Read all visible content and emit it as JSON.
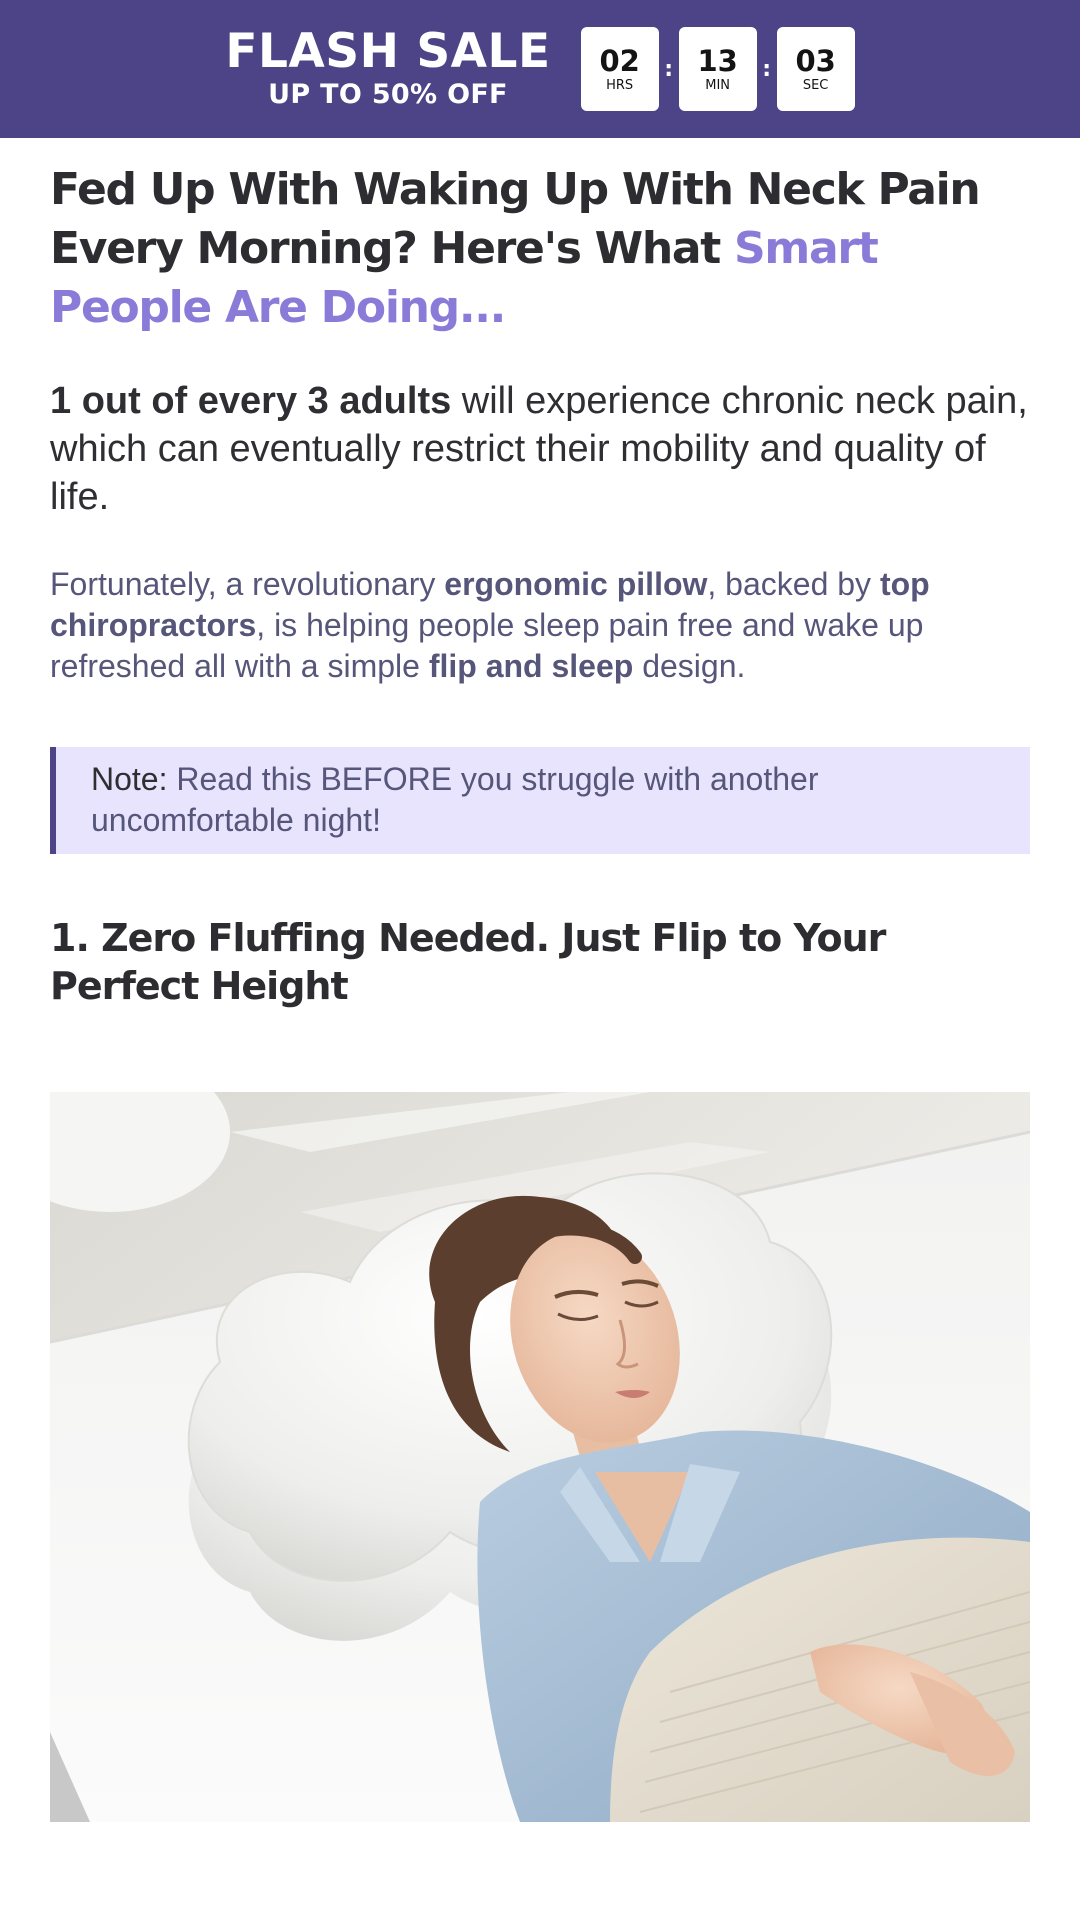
{
  "banner": {
    "title": "FLASH SALE",
    "subtitle": "UP TO 50% OFF",
    "background_color": "#4c4486",
    "timer": {
      "hours": "02",
      "hours_label": "HRS",
      "minutes": "13",
      "minutes_label": "MIN",
      "seconds": "03",
      "seconds_label": "SEC",
      "separator": ":"
    }
  },
  "article": {
    "headline_main": "Fed Up With Waking Up With Neck Pain Every Morning? Here's What ",
    "headline_accent": "Smart People Are Doing...",
    "accent_color": "#8b7bd8",
    "lead_bold": "1 out of every 3 adults",
    "lead_rest": " will experience chronic neck pain, which can eventually restrict their mobility and quality of life.",
    "para": {
      "t1": "Fortunately, a revolutionary ",
      "b1": "ergonomic pillow",
      "t2": ", backed by ",
      "b2": "top chiropractors",
      "t3": ", is helping people sleep pain free and wake up refreshed all with a simple ",
      "b3": "flip and sleep",
      "t4": " design."
    },
    "note": {
      "label": "Note:",
      "text": " Read this BEFORE you struggle with another uncomfortable night!",
      "background_color": "#e8e4fd"
    },
    "section_heading": "1. Zero Fluffing Needed. Just Flip to Your Perfect Height",
    "photo_icon": "woman-sleeping-on-pillow-photo"
  }
}
